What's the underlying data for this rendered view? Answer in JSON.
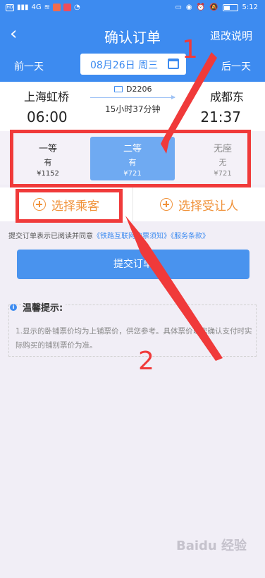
{
  "status_bar": {
    "time": "5:12",
    "hd_badge": "HD",
    "signal_text": "4G"
  },
  "header": {
    "back_icon": "‹",
    "title": "确认订单",
    "policy_link": "退改说明"
  },
  "date_bar": {
    "prev_day": "前一天",
    "date": "08月26日 周三",
    "next_day": "后一天"
  },
  "train": {
    "from_station": "上海虹桥",
    "to_station": "成都东",
    "train_number": "D2206",
    "departure_time": "06:00",
    "arrival_time": "21:37",
    "duration": "15小时37分钟"
  },
  "seats": [
    {
      "name": "一等",
      "availability": "有",
      "price": "¥1152"
    },
    {
      "name": "二等",
      "availability": "有",
      "price": "¥721"
    },
    {
      "name": "无座",
      "availability": "无",
      "price": "¥721"
    }
  ],
  "passengers": {
    "select_passenger": "选择乘客",
    "select_beneficiary": "选择受让人"
  },
  "agreement": {
    "prefix": "提交订单表示已阅读并同意",
    "link1": "《铁路互联网购票须知》",
    "link2": "《服务条款》"
  },
  "submit_label": "提交订单",
  "tips": {
    "title": "温馨提示:",
    "text": "1.显示的卧铺票价均为上铺票价，供您参考。具体票价以您确认支付时实际购买的铺别票价为准。"
  },
  "annotations": {
    "marker_1": "1",
    "marker_2": "2"
  },
  "watermark": "Baidu 经验",
  "colors": {
    "primary": "#3d8bf0",
    "selected_seat": "#6faaf2",
    "accent_orange": "#f0923a",
    "annotation_red": "#f03a3a"
  }
}
